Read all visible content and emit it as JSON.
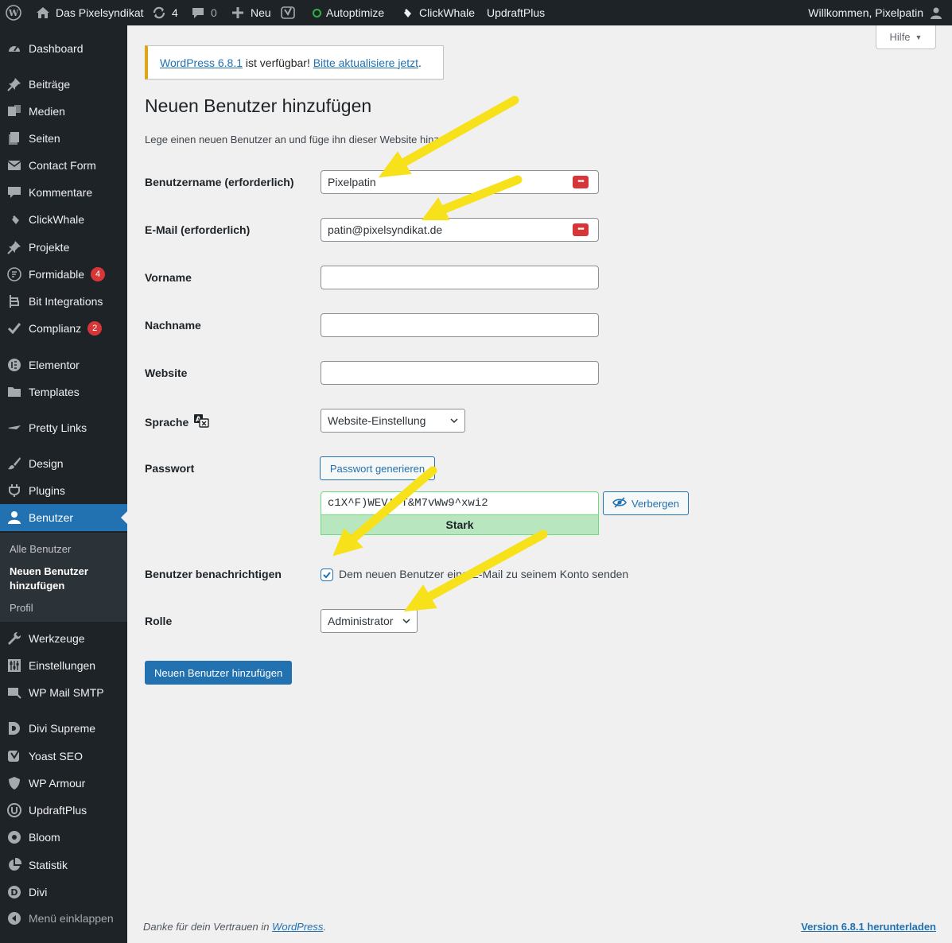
{
  "admin_bar": {
    "site_name": "Das Pixelsyndikat",
    "updates_count": "4",
    "comments_count": "0",
    "new_label": "Neu",
    "autoptimize_label": "Autoptimize",
    "clickwhale_label": "ClickWhale",
    "updraftplus_label": "UpdraftPlus",
    "greeting": "Willkommen, Pixelpatin"
  },
  "help_tab": {
    "label": "Hilfe"
  },
  "sidebar": {
    "items": [
      {
        "label": "Dashboard",
        "icon": "dashboard-icon"
      },
      {
        "label": "Beiträge",
        "icon": "pin-icon"
      },
      {
        "label": "Medien",
        "icon": "media-icon"
      },
      {
        "label": "Seiten",
        "icon": "pages-icon"
      },
      {
        "label": "Contact Form",
        "icon": "mail-icon"
      },
      {
        "label": "Kommentare",
        "icon": "comment-icon"
      },
      {
        "label": "ClickWhale",
        "icon": "clickwhale-icon"
      },
      {
        "label": "Projekte",
        "icon": "pin-icon"
      },
      {
        "label": "Formidable",
        "icon": "formidable-icon",
        "badge": "4"
      },
      {
        "label": "Bit Integrations",
        "icon": "bit-icon"
      },
      {
        "label": "Complianz",
        "icon": "check-icon",
        "badge": "2"
      },
      {
        "label": "Elementor",
        "icon": "elementor-icon"
      },
      {
        "label": "Templates",
        "icon": "folder-icon"
      },
      {
        "label": "Pretty Links",
        "icon": "star-icon"
      },
      {
        "label": "Design",
        "icon": "brush-icon"
      },
      {
        "label": "Plugins",
        "icon": "plugin-icon"
      },
      {
        "label": "Benutzer",
        "icon": "user-icon"
      },
      {
        "label": "Werkzeuge",
        "icon": "wrench-icon"
      },
      {
        "label": "Einstellungen",
        "icon": "settings-icon"
      },
      {
        "label": "WP Mail SMTP",
        "icon": "mail-smtp-icon"
      },
      {
        "label": "Divi Supreme",
        "icon": "divi-supreme-icon"
      },
      {
        "label": "Yoast SEO",
        "icon": "yoast-icon"
      },
      {
        "label": "WP Armour",
        "icon": "shield-icon"
      },
      {
        "label": "UpdraftPlus",
        "icon": "updraft-icon"
      },
      {
        "label": "Bloom",
        "icon": "bloom-icon"
      },
      {
        "label": "Statistik",
        "icon": "pie-icon"
      },
      {
        "label": "Divi",
        "icon": "divi-icon"
      }
    ],
    "submenu": [
      "Alle Benutzer",
      "Neuen Benutzer hinzufügen",
      "Profil"
    ],
    "collapse_label": "Menü einklappen"
  },
  "notice": {
    "version_link": "WordPress 6.8.1",
    "middle": " ist verfügbar! ",
    "update_link": "Bitte aktualisiere jetzt",
    "end": "."
  },
  "page": {
    "title": "Neuen Benutzer hinzufügen",
    "intro": "Lege einen neuen Benutzer an und füge ihn dieser Website hinzu."
  },
  "form": {
    "username_label": "Benutzername (erforderlich)",
    "username_value": "Pixelpatin",
    "email_label": "E-Mail (erforderlich)",
    "email_value": "patin@pixelsyndikat.de",
    "firstname_label": "Vorname",
    "lastname_label": "Nachname",
    "website_label": "Website",
    "language_label": "Sprache",
    "language_value": "Website-Einstellung",
    "password_label": "Passwort",
    "generate_password_label": "Passwort generieren",
    "password_value": "c1X^F)WEV!!T&M7vWw9^xwi2",
    "hide_label": "Verbergen",
    "strength_label": "Stark",
    "notify_label": "Benutzer benachrichtigen",
    "notify_text": "Dem neuen Benutzer eine E-Mail zu seinem Konto senden",
    "notify_checked": true,
    "role_label": "Rolle",
    "role_value": "Administrator",
    "submit_label": "Neuen Benutzer hinzufügen"
  },
  "footer": {
    "thanks_prefix": "Danke für dein Vertrauen in ",
    "thanks_link": "WordPress",
    "thanks_suffix": ".",
    "version_link": "Version 6.8.1 herunterladen"
  },
  "colors": {
    "admin_bar_bg": "#1d2327",
    "menu_current": "#2271b1",
    "notice_border": "#dba617",
    "annotation_arrow": "#f7e11b",
    "badge": "#d63638"
  }
}
